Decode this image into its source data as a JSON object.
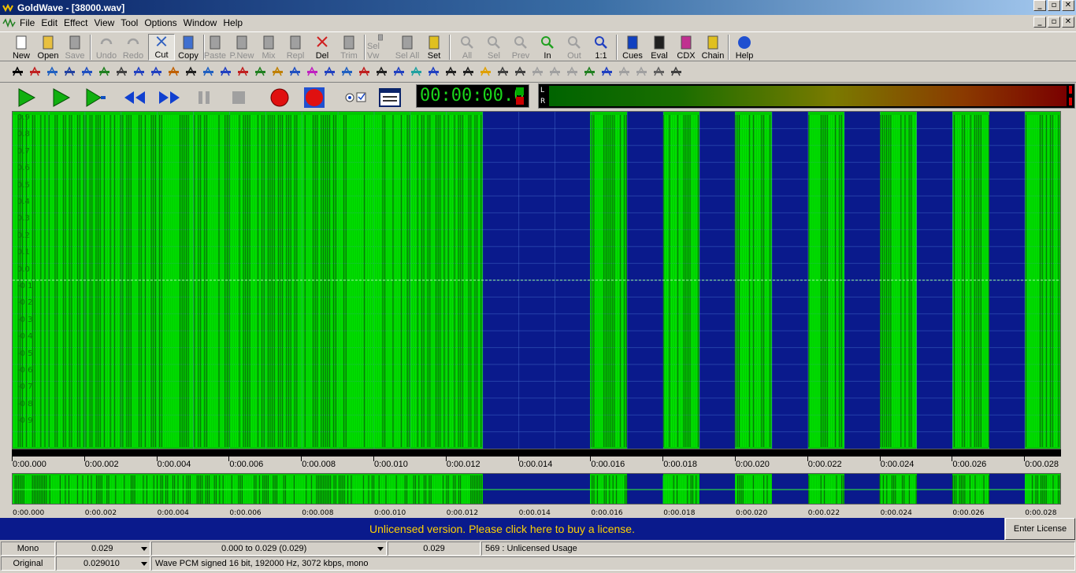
{
  "title": "GoldWave - [38000.wav]",
  "menu": [
    "File",
    "Edit",
    "Effect",
    "View",
    "Tool",
    "Options",
    "Window",
    "Help"
  ],
  "toolbar": [
    {
      "label": "New",
      "icon": "new-file-icon",
      "enabled": true
    },
    {
      "label": "Open",
      "icon": "open-folder-icon",
      "enabled": true
    },
    {
      "label": "Save",
      "icon": "save-disk-icon",
      "enabled": false
    },
    {
      "label": "Undo",
      "icon": "undo-icon",
      "enabled": false
    },
    {
      "label": "Redo",
      "icon": "redo-icon",
      "enabled": false
    },
    {
      "label": "Cut",
      "icon": "scissors-icon",
      "enabled": true,
      "pressed": true
    },
    {
      "label": "Copy",
      "icon": "copy-icon",
      "enabled": true
    },
    {
      "label": "Paste",
      "icon": "paste-icon",
      "enabled": false
    },
    {
      "label": "P.New",
      "icon": "paste-new-icon",
      "enabled": false
    },
    {
      "label": "Mix",
      "icon": "mix-icon",
      "enabled": false
    },
    {
      "label": "Repl",
      "icon": "replace-icon",
      "enabled": false
    },
    {
      "label": "Del",
      "icon": "delete-icon",
      "enabled": true
    },
    {
      "label": "Trim",
      "icon": "trim-icon",
      "enabled": false
    },
    {
      "label": "Sel Vw",
      "icon": "select-view-icon",
      "enabled": false
    },
    {
      "label": "Sel All",
      "icon": "select-all-icon",
      "enabled": false
    },
    {
      "label": "Set",
      "icon": "set-icon",
      "enabled": true
    },
    {
      "label": "All",
      "icon": "zoom-all-icon",
      "enabled": false
    },
    {
      "label": "Sel",
      "icon": "zoom-selection-icon",
      "enabled": false
    },
    {
      "label": "Prev",
      "icon": "zoom-previous-icon",
      "enabled": false
    },
    {
      "label": "In",
      "icon": "zoom-in-icon",
      "enabled": true
    },
    {
      "label": "Out",
      "icon": "zoom-out-icon",
      "enabled": false
    },
    {
      "label": "1:1",
      "icon": "zoom-1-1-icon",
      "enabled": true
    },
    {
      "label": "Cues",
      "icon": "cues-icon",
      "enabled": true
    },
    {
      "label": "Eval",
      "icon": "eval-icon",
      "enabled": true
    },
    {
      "label": "CDX",
      "icon": "cdx-icon",
      "enabled": true
    },
    {
      "label": "Chain",
      "icon": "chain-icon",
      "enabled": true
    },
    {
      "label": "Help",
      "icon": "help-icon",
      "enabled": true
    }
  ],
  "transport": {
    "time": "00:00:00.0",
    "meter_labels": [
      "L",
      "R"
    ]
  },
  "waveform": {
    "scale_labels": [
      "0.9",
      "0.8",
      "0.7",
      "0.6",
      "0.5",
      "0.4",
      "0.3",
      "0.2",
      "0.1",
      "0.0",
      "-0.1",
      "-0.2",
      "-0.3",
      "-0.4",
      "-0.5",
      "-0.6",
      "-0.7",
      "-0.8",
      "-0.9"
    ],
    "colors": {
      "wave": "#00e600",
      "selected_bg": "#00c800",
      "unselected_bg": "#0a1a8c"
    }
  },
  "timeline": {
    "ticks": [
      "0:00.000",
      "0:00.002",
      "0:00.004",
      "0:00.006",
      "0:00.008",
      "0:00.010",
      "0:00.012",
      "0:00.014",
      "0:00.016",
      "0:00.018",
      "0:00.020",
      "0:00.022",
      "0:00.024",
      "0:00.026",
      "0:00.028"
    ]
  },
  "license": {
    "message": "Unlicensed version. Please click here to buy a license.",
    "button": "Enter License"
  },
  "status": {
    "row1": {
      "channel": "Mono",
      "length": "0.029",
      "selection": "0.000 to 0.029 (0.029)",
      "position": "0.029",
      "info": "569 : Unlicensed Usage"
    },
    "row2": {
      "mode": "Original",
      "value": "0.029010",
      "format": "Wave PCM signed 16 bit, 192000 Hz, 3072 kbps, mono"
    }
  }
}
